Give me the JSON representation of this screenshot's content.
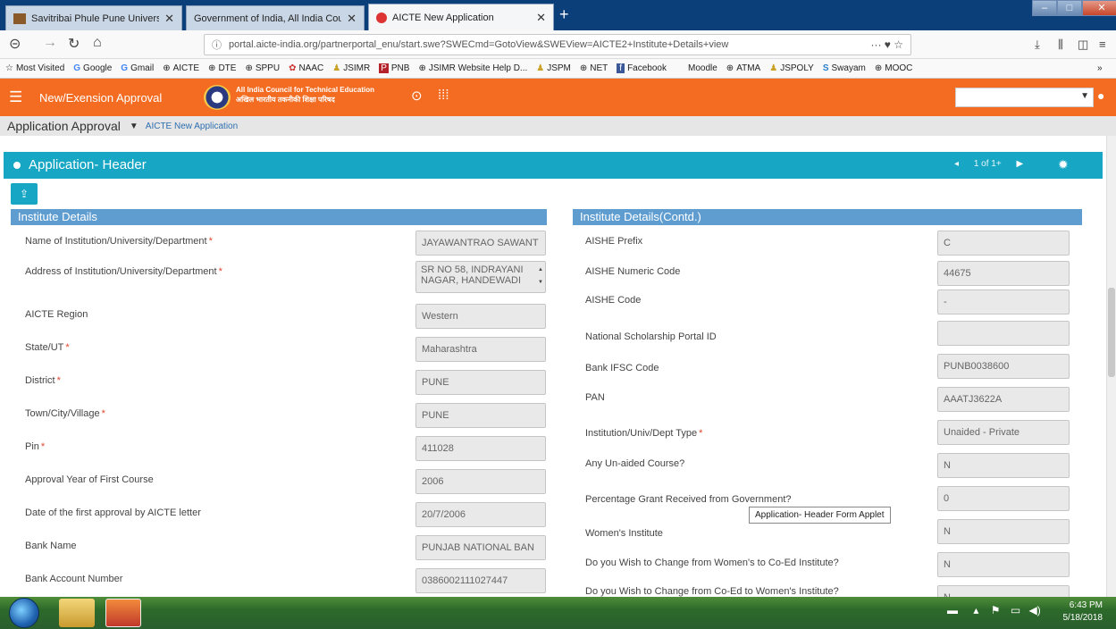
{
  "browser": {
    "tabs": [
      {
        "title": "Savitribai Phule Pune Universit",
        "active": false
      },
      {
        "title": "Government of India, All India Cou",
        "active": false
      },
      {
        "title": "AICTE New Application",
        "active": true
      }
    ],
    "new_tab_label": "+",
    "url": "portal.aicte-india.org/partnerportal_enu/start.swe?SWECmd=GotoView&SWEView=AICTE2+Institute+Details+view",
    "url_actions": "··· ♥ ☆",
    "bookmarks": [
      {
        "label": "Most Visited",
        "icon": "star-icon"
      },
      {
        "label": "Google",
        "icon": "google-icon"
      },
      {
        "label": "Gmail",
        "icon": "google-icon"
      },
      {
        "label": "AICTE",
        "icon": "globe-icon"
      },
      {
        "label": "DTE",
        "icon": "globe-icon"
      },
      {
        "label": "SPPU",
        "icon": "globe-icon"
      },
      {
        "label": "NAAC",
        "icon": "globe-icon"
      },
      {
        "label": "JSIMR",
        "icon": "folder-icon"
      },
      {
        "label": "PNB",
        "icon": "pnb-icon"
      },
      {
        "label": "JSIMR Website Help D...",
        "icon": "globe-icon"
      },
      {
        "label": "JSPM",
        "icon": "folder-icon"
      },
      {
        "label": "NET",
        "icon": "globe-icon"
      },
      {
        "label": "Facebook",
        "icon": "facebook-icon"
      },
      {
        "label": "Moodle",
        "icon": "none"
      },
      {
        "label": "ATMA",
        "icon": "globe-icon"
      },
      {
        "label": "JSPOLY",
        "icon": "folder-icon"
      },
      {
        "label": "Swayam",
        "icon": "swayam-icon"
      },
      {
        "label": "MOOC",
        "icon": "globe-icon"
      }
    ],
    "overflow": "»"
  },
  "app_header": {
    "title": "New/Exension Approval",
    "org_name_en": "All India Council for Technical Education",
    "org_name_hi": "अखिल भारतीय तकनीकी शिक्षा परिषद",
    "colors": {
      "header": "#f36c21",
      "applet": "#17a6c4",
      "section": "#5f9dd1"
    }
  },
  "breadcrumb": {
    "screen": "Application Approval",
    "view": "AICTE New Application"
  },
  "applet": {
    "title": "Application- Header",
    "record_nav": "1 of 1+",
    "tooltip": "Application- Header Form Applet"
  },
  "left_section": {
    "title": "Institute Details",
    "fields": [
      {
        "label": "Name of Institution/University/Department",
        "required": true,
        "value": "JAYAWANTRAO SAWANT"
      },
      {
        "label": "Address of Institution/University/Department",
        "required": true,
        "value": "SR NO 58, INDRAYANI NAGAR, HANDEWADI"
      },
      {
        "label": "AICTE Region",
        "required": false,
        "value": "Western"
      },
      {
        "label": "State/UT",
        "required": true,
        "value": "Maharashtra"
      },
      {
        "label": "District",
        "required": true,
        "value": "PUNE"
      },
      {
        "label": "Town/City/Village",
        "required": true,
        "value": "PUNE"
      },
      {
        "label": "Pin",
        "required": true,
        "value": "411028"
      },
      {
        "label": "Approval Year of First Course",
        "required": false,
        "value": "2006"
      },
      {
        "label": "Date of the first approval by AICTE letter",
        "required": false,
        "value": "20/7/2006"
      },
      {
        "label": "Bank Name",
        "required": false,
        "value": "PUNJAB NATIONAL BAN"
      },
      {
        "label": "Bank Account Number",
        "required": false,
        "value": "0386002111027447"
      }
    ]
  },
  "right_section": {
    "title": "Institute Details(Contd.)",
    "fields": [
      {
        "label": "AISHE Prefix",
        "required": false,
        "value": "C"
      },
      {
        "label": "AISHE Numeric Code",
        "required": false,
        "value": "44675"
      },
      {
        "label": "AISHE Code",
        "required": false,
        "value": "-"
      },
      {
        "label": "National Scholarship Portal ID",
        "required": false,
        "value": ""
      },
      {
        "label": "Bank IFSC Code",
        "required": false,
        "value": "PUNB0038600"
      },
      {
        "label": "PAN",
        "required": false,
        "value": "AAATJ3622A"
      },
      {
        "label": "Institution/Univ/Dept Type",
        "required": true,
        "value": "Unaided - Private"
      },
      {
        "label": "Any Un-aided Course?",
        "required": false,
        "value": "N"
      },
      {
        "label": "Percentage Grant Received from Government?",
        "required": false,
        "value": "0"
      },
      {
        "label": "Women's Institute",
        "required": false,
        "value": "N"
      },
      {
        "label": "Do you Wish to Change from Women's to Co-Ed Institute?",
        "required": false,
        "value": "N"
      },
      {
        "label": "Do you Wish to Change from Co-Ed to Women's Institute?",
        "required": false,
        "value": "N"
      }
    ]
  },
  "taskbar": {
    "time": "6:43 PM",
    "date": "5/18/2018"
  }
}
